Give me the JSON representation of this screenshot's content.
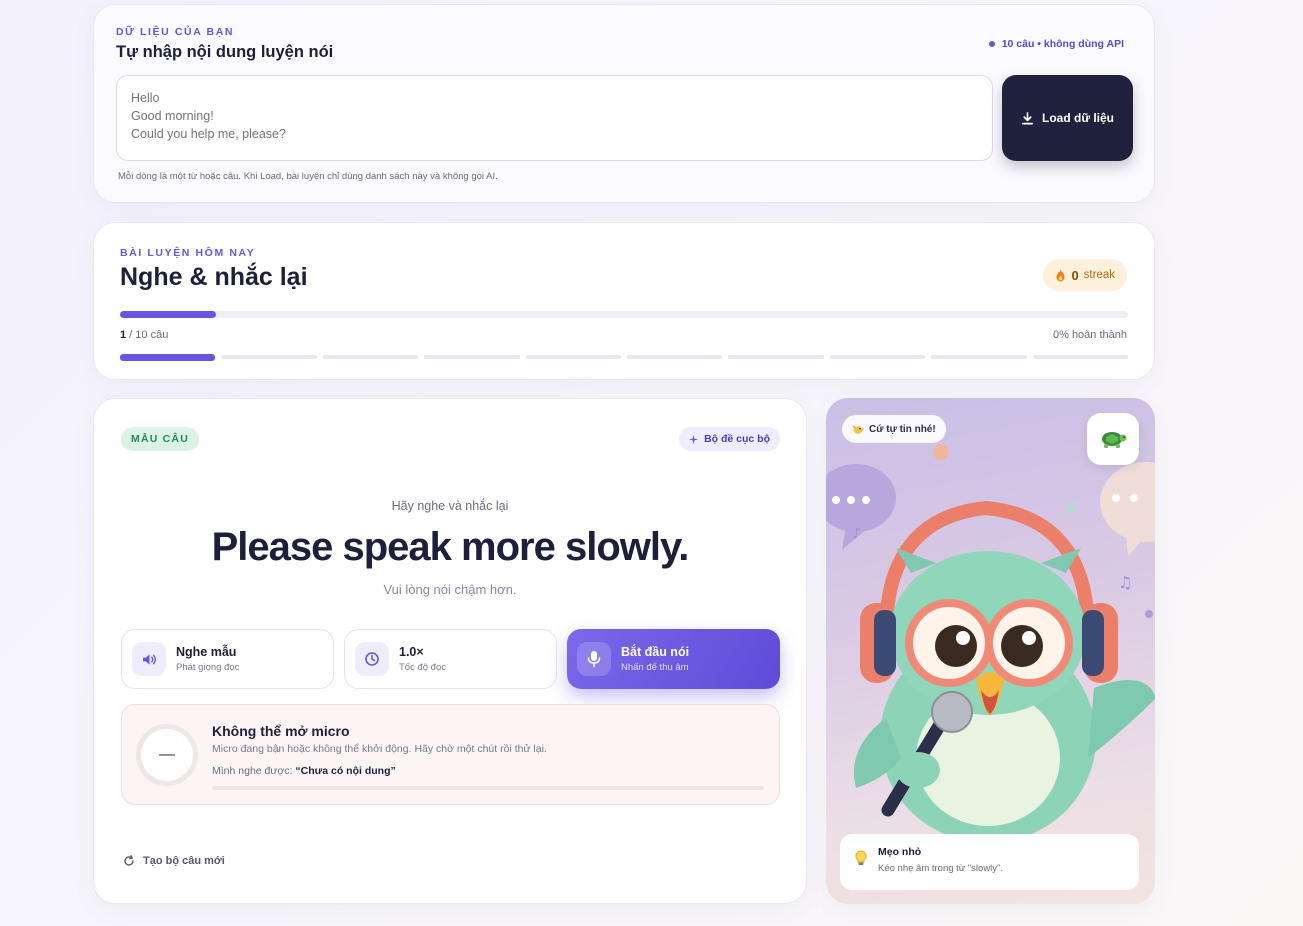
{
  "data_card": {
    "eyebrow": "DỮ LIỆU CỦA BẠN",
    "title": "Tự nhập nội dung luyện nói",
    "api_badge": "10 câu • không dùng API",
    "textarea_placeholder": "Hello\nGood morning!\nCould you help me, please?",
    "load_button": "Load dữ liệu",
    "hint": "Mỗi dòng là một từ hoặc câu. Khi Load, bài luyện chỉ dùng danh sách này và không gọi AI."
  },
  "lesson_card": {
    "eyebrow": "BÀI LUYỆN HÔM NAY",
    "title": "Nghe & nhắc lại",
    "streak_count": "0",
    "streak_label": "streak",
    "current": "1",
    "total_label": " / 10 câu",
    "percent_label": "0% hoàn thành",
    "progress_fraction": 0.095,
    "segments_total": 10,
    "segments_active": 1
  },
  "practice_card": {
    "tag": "MẪU CÂU",
    "local_tag": "Bộ đề cục bộ",
    "prompt": "Hãy nghe và nhắc lại",
    "sentence": "Please speak more slowly.",
    "translation": "Vui lòng nói chậm hơn.",
    "actions": {
      "listen": {
        "label": "Nghe mẫu",
        "sub": "Phát giọng đọc",
        "icon": "speaker-icon"
      },
      "speed": {
        "label": "1.0×",
        "sub": "Tốc độ đọc",
        "icon": "clock-icon"
      },
      "speak": {
        "label": "Bắt đầu nói",
        "sub": "Nhấn để thu âm",
        "icon": "microphone-icon"
      }
    },
    "error": {
      "score": "—",
      "title": "Không thể mở micro",
      "desc": "Micro đang bận hoặc không thể khởi động. Hãy chờ một chút rồi thử lại.",
      "heard_label": "Mình nghe được:",
      "heard_value": "“Chưa có nội dung”"
    },
    "new_set": "Tạo bộ câu mới"
  },
  "mascot_card": {
    "bubble": "Cứ tự tin nhé!",
    "tip_title": "Mẹo nhỏ",
    "tip_text": "Kéo nhẹ âm trong từ \"slowly\"."
  },
  "colors": {
    "accent": "#6a55e0",
    "dark": "#20213c",
    "success": "#248a55",
    "streak": "#b36b14"
  }
}
